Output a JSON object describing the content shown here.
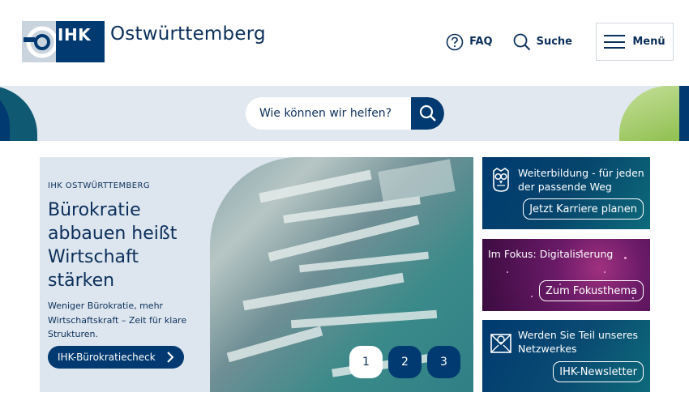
{
  "header": {
    "logo_text": "IHK",
    "logo_region": "Ostwürttemberg",
    "nav": {
      "faq_label": "FAQ",
      "search_label": "Suche",
      "menu_label": "Menü"
    }
  },
  "search": {
    "placeholder": "Wie können wir helfen?"
  },
  "hero": {
    "kicker": "IHK OSTWÜRTTEMBERG",
    "title_lines": [
      "Bürokratie",
      "abbauen heißt",
      "Wirtschaft",
      "stärken"
    ],
    "description": "Weniger Bürokratie, mehr Wirtschaftskraft – Zeit für klare Strukturen.",
    "cta_label": "IHK-Bürokratiecheck",
    "slides": [
      "1",
      "2",
      "3"
    ],
    "active_slide": "1"
  },
  "teasers": [
    {
      "title": "Weiterbildung - für jeden der passende Weg",
      "button": "Jetzt Karriere planen",
      "icon": "owl-icon"
    },
    {
      "title": "Im Fokus: Digitalisierung",
      "button": "Zum Fokusthema",
      "icon": ""
    },
    {
      "title": "Werden Sie Teil unseres Netzwerkes",
      "button": "IHK-Newsletter",
      "icon": "newsletter-icon"
    }
  ],
  "colors": {
    "brand_blue": "#003a70",
    "text": "#0b2f5b",
    "band": "#e1e8f0",
    "accent_green": "#8fbf4f",
    "focus_magenta": "#a0317f"
  }
}
